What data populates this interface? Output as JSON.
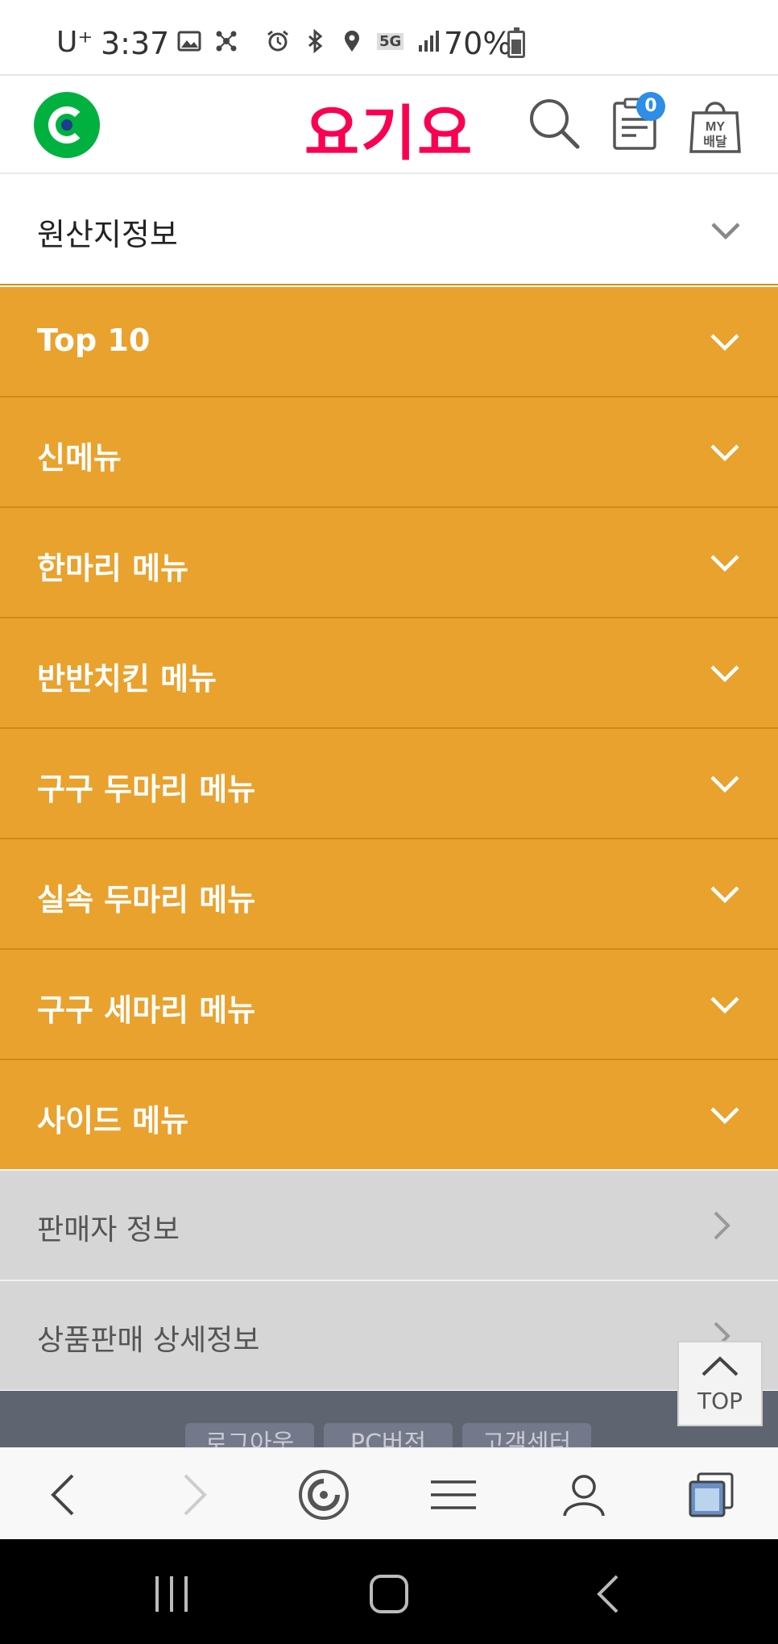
{
  "status_bar": {
    "carrier": "U⁺",
    "time": "3:37",
    "network": "5G",
    "battery": "70%"
  },
  "header": {
    "brand": "요기요",
    "orders_badge": "0",
    "my_delivery_label": "MY 배달"
  },
  "origin": {
    "label": "원산지정보"
  },
  "menus": [
    {
      "label": "Top 10"
    },
    {
      "label": "신메뉴"
    },
    {
      "label": "한마리 메뉴"
    },
    {
      "label": "반반치킨 메뉴"
    },
    {
      "label": "구구 두마리 메뉴"
    },
    {
      "label": "실속 두마리 메뉴"
    },
    {
      "label": "구구 세마리 메뉴"
    },
    {
      "label": "사이드 메뉴"
    }
  ],
  "info_rows": [
    {
      "label": "판매자 정보"
    },
    {
      "label": "상품판매 상세정보"
    }
  ],
  "footer": {
    "links": [
      "로그아웃",
      "PC버전",
      "고객센터"
    ]
  },
  "top_button": {
    "label": "TOP"
  },
  "colors": {
    "brand": "#fa0050",
    "menu_bg": "#e9a22e",
    "info_bg": "#d6d6d6",
    "badge": "#2d8de7",
    "gmarket_green": "#00b140"
  }
}
